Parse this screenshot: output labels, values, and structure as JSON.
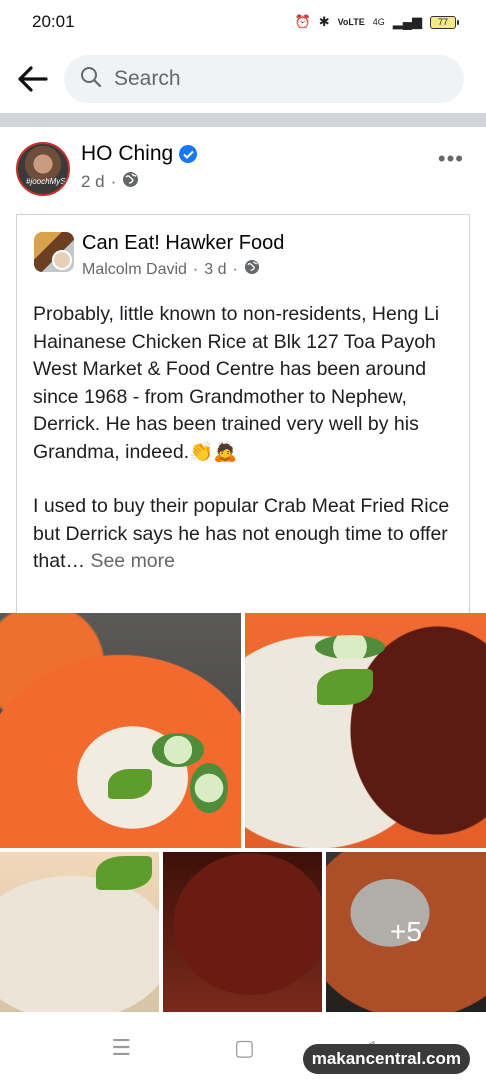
{
  "status_bar": {
    "time": "20:01",
    "network_label": "VoLTE",
    "signal_label": "4G",
    "battery": "77"
  },
  "search": {
    "placeholder": "Search"
  },
  "post": {
    "author": "HO Ching",
    "time": "2 d",
    "avatar_caption": "#joochMySelf"
  },
  "shared_post": {
    "group_name": "Can Eat! Hawker Food",
    "author": "Malcolm David",
    "time": "3 d",
    "paragraph_1": "Probably, little known to non-residents, Heng Li Hainanese Chicken Rice at Blk 127 Toa Payoh West Market & Food Centre has been around since 1968 - from Grandmother to Nephew, Derrick. He has been trained very well by his Grandma, indeed.👏🙇",
    "paragraph_2": "I used to buy their popular Crab Meat Fried Rice but Derrick says he has not enough time to offer that…",
    "see_more": "See more"
  },
  "photos": {
    "more_count": "+5"
  },
  "watermark": "makancentral.com",
  "colors": {
    "verified": "#1877f2",
    "divider": "#d1d4d8"
  }
}
